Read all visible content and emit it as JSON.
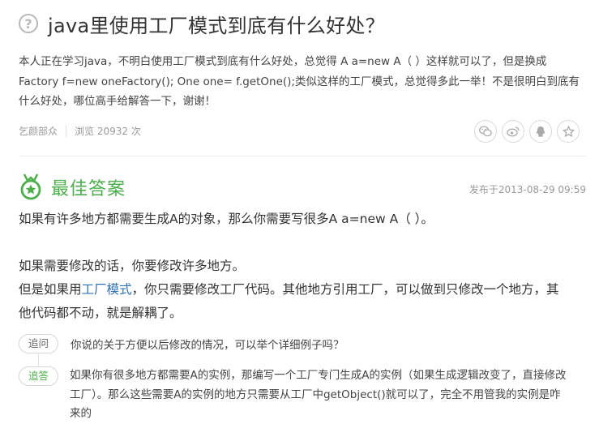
{
  "question": {
    "icon": "question-circle-icon",
    "title": "java里使用工厂模式到底有什么好处？",
    "description_line1": "本人正在学习java，不明白使用工厂模式到底有什么好处，总觉得 A a=new A（ ）这样就可以了，但是换成",
    "description_line2": "Factory f=new oneFactory(); One one= f.getOne();类似这样的工厂模式，总觉得多此一举！不是很明白到底有",
    "description_line3": "什么好处，哪位高手给解答一下，谢谢！",
    "author": "乞颜部众",
    "views": "浏览 20932 次"
  },
  "share": {
    "icons": [
      "wechat-icon",
      "weibo-icon",
      "qq-icon",
      "star-icon"
    ]
  },
  "best_answer": {
    "heading": "最佳答案",
    "date": "发布于2013-08-29 09:59",
    "para1": "如果有许多地方都需要生成A的对象，那么你需要写很多A  a=new A（ ）。",
    "para2": "如果需要修改的话，你要修改许多地方。",
    "para3_pre": "但是如果用",
    "para3_link": "工厂模式",
    "para3_post": "，你只需要修改工厂代码。其他地方引用工厂，可以做到只修改一个地方，其",
    "para4": "他代码都不动，就是解耦了。"
  },
  "followups": {
    "ask_tag": "追问",
    "ask_text": "你说的关于方便以后修改的情况，可以举个详细例子吗？",
    "reply_tag": "追答",
    "reply_line1": "如果你有很多地方都需要A的实例，那编写一个工厂专门生成A的实例（如果生成逻辑改变了，直接修改",
    "reply_line2": "工厂）。那么这些需要A的实例的地方只需要从工厂中getObject()就可以了，完全不用管我的实例是咋",
    "reply_line3": "来的"
  },
  "colors": {
    "green": "#4cae4c",
    "link": "#3072b3",
    "muted": "#999999"
  }
}
